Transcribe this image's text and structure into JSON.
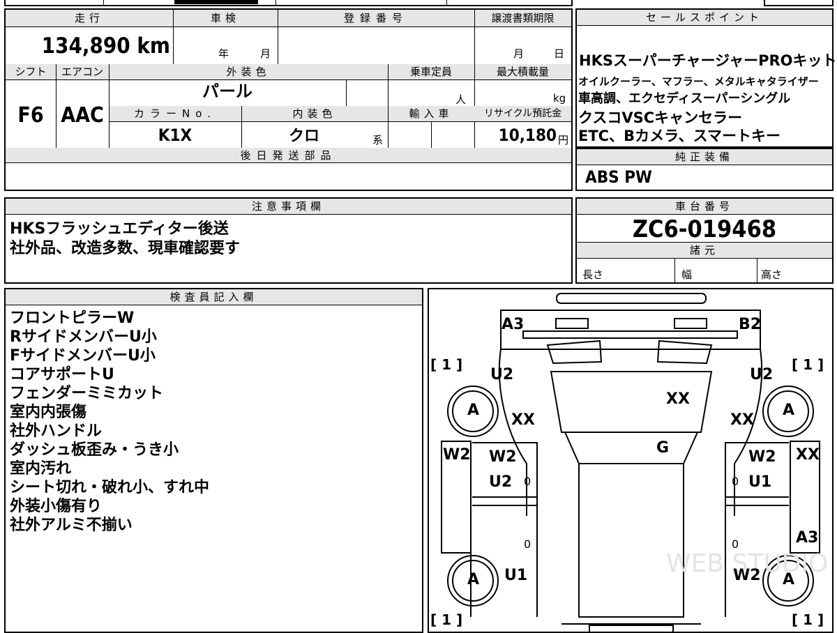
{
  "mileage": {
    "label": "走行",
    "value": "134,890",
    "unit": "km"
  },
  "inspection": {
    "label": "車検",
    "year_unit": "年",
    "month_unit": "月"
  },
  "registration": {
    "label": "登録番号"
  },
  "transfer": {
    "label": "譲渡書類期限",
    "month_unit": "月",
    "day_unit": "日"
  },
  "shift": {
    "label": "シフト",
    "value": "F6"
  },
  "aircon": {
    "label": "エアコン",
    "value": "AAC"
  },
  "exterior_color": {
    "label": "外装色",
    "value": "パール"
  },
  "capacity": {
    "label": "乗車定員",
    "unit": "人"
  },
  "max_load": {
    "label": "最大積載量",
    "unit": "kg"
  },
  "color_no": {
    "label": "カラーNo.",
    "value": "K1X"
  },
  "interior_color": {
    "label": "内装色",
    "value": "クロ",
    "suffix": "系"
  },
  "import": {
    "label": "輸入車"
  },
  "recycle": {
    "label": "リサイクル預託金",
    "value": "10,180",
    "unit": "円"
  },
  "later_parts": {
    "label": "後日発送部品"
  },
  "sales_points": {
    "label": "セールスポイント",
    "lines": [
      "HKSスーパーチャージャーPROキット",
      "オイルクーラー、マフラー、メタルキャタライザー",
      "車高調、エクセディスーパーシングル",
      "クスコVSCキャンセラー",
      "ETC、Bカメラ、スマートキー"
    ]
  },
  "genuine": {
    "label": "純正装備",
    "value": "ABS PW"
  },
  "notes": {
    "label": "注意事項欄",
    "lines": [
      "HKSフラッシュエディター後送",
      "社外品、改造多数、現車確認要す"
    ]
  },
  "chassis": {
    "label": "車台番号",
    "value": "ZC6-019468"
  },
  "specs": {
    "label": "諸元",
    "length": "長さ",
    "width": "幅",
    "height": "高さ"
  },
  "inspector": {
    "label": "検査員記入欄",
    "lines": [
      "フロントピラーW",
      "RサイドメンバーU小",
      "FサイドメンバーU小",
      "コアサポートU",
      "フェンダーミミカット",
      "室内内張傷",
      "社外ハンドル",
      "ダッシュ板歪み・うき小",
      "室内汚れ",
      "シート切れ・破れ小、すれ中",
      "外装小傷有り",
      "社外アルミ不揃い"
    ]
  },
  "diagram": {
    "marks": {
      "a3_front": "A3",
      "b2": "B2",
      "u2_fl": "U2",
      "u2_fr": "U2",
      "xx_hood": "XX",
      "xx_l": "XX",
      "xx_r": "XX",
      "g": "G",
      "w2_lside": "W2",
      "w2_ldoor": "W2",
      "u2_ldoor": "U2",
      "w2_rdoor": "W2",
      "u1_rdoor": "U1",
      "xx_rside": "XX",
      "a3_rside": "A3",
      "u1_rl": "U1",
      "w2_rr": "W2"
    },
    "tires": {
      "fl": "A",
      "fr": "A",
      "rl": "A",
      "rr": "A"
    },
    "counts": {
      "fl": "[ 1 ]",
      "fr": "[ 1 ]",
      "rl": "[ 1 ]",
      "rr": "[ 1 ]"
    },
    "zeros": {
      "a": "0",
      "b": "0",
      "c": "0",
      "d": "0"
    },
    "watermark": "WEB STUDIO"
  }
}
